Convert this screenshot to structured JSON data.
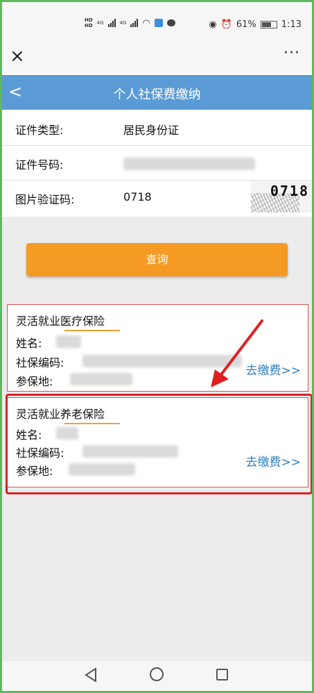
{
  "status_bar": {
    "network_label": "4G",
    "network_label_2": "4G",
    "battery_percent": "61%",
    "time": "1:13"
  },
  "app_header": {
    "close_glyph": "×",
    "more_glyph": "···"
  },
  "page": {
    "back_glyph": "<",
    "title": "个人社保费缴纳"
  },
  "form": {
    "id_type_label": "证件类型:",
    "id_type_value": "居民身份证",
    "id_number_label": "证件号码:",
    "captcha_label": "图片验证码:",
    "captcha_value": "0718",
    "captcha_image_text": "0718"
  },
  "query_button_label": "查询",
  "cards": [
    {
      "title_prefix": "灵活就业",
      "title_highlight": "医疗保险",
      "name_label": "姓名:",
      "ss_number_label": "社保编码:",
      "location_label": "参保地:",
      "pay_link": "去缴费>>"
    },
    {
      "title_prefix": "灵活就业",
      "title_highlight": "养老保险",
      "name_label": "姓名:",
      "ss_number_label": "社保编码:",
      "location_label": "参保地:",
      "pay_link": "去缴费>>"
    }
  ],
  "colors": {
    "title_bar": "#5b9bd5",
    "query_button": "#f59a23",
    "highlight_border": "#e02020",
    "link": "#2f7fc1"
  }
}
